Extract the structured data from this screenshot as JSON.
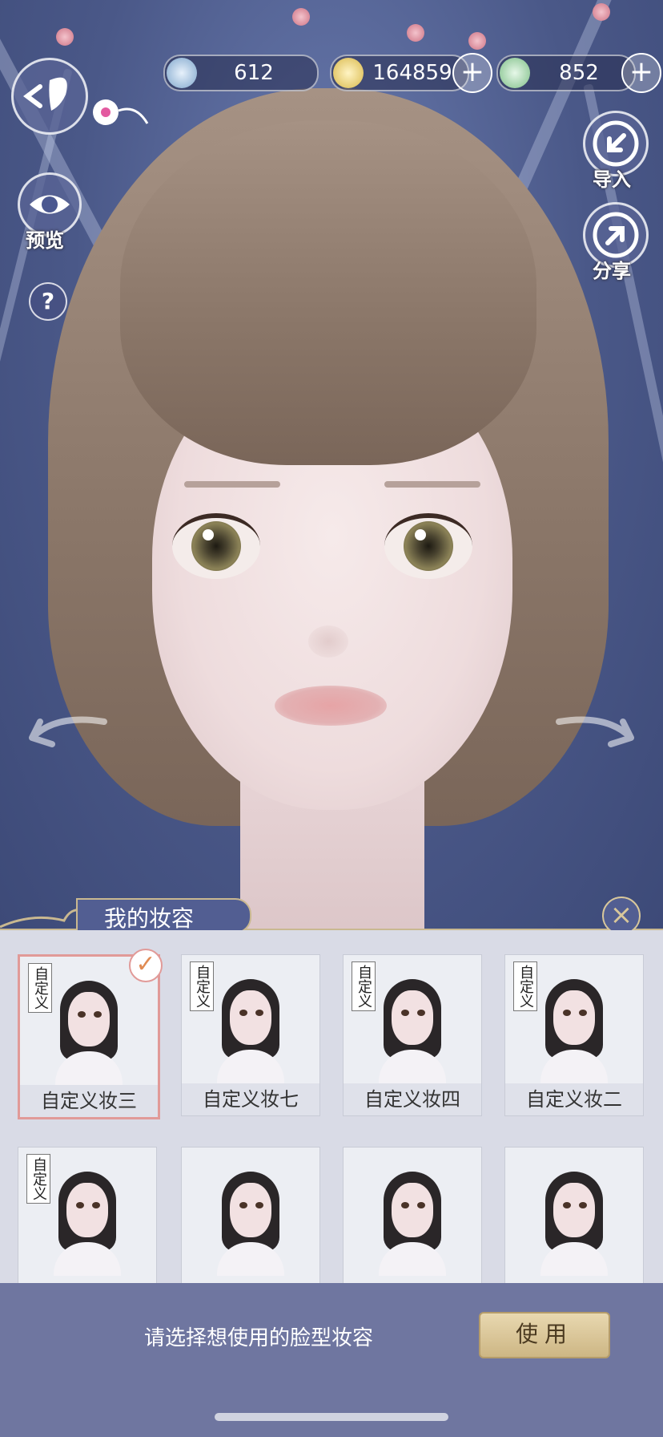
{
  "currencies": [
    {
      "name": "jade",
      "value": "612",
      "color": "#8fb6d8"
    },
    {
      "name": "copper-coin",
      "value": "164859",
      "color": "#e6cf7a"
    },
    {
      "name": "jade-token",
      "value": "852",
      "color": "#9fd6a4"
    }
  ],
  "left_controls": {
    "preview_label": "预览",
    "help_label": "?"
  },
  "right_controls": {
    "import_label": "导入",
    "share_label": "分享"
  },
  "panel": {
    "title": "我的妆容",
    "close_label": "×",
    "tag_text": "自定义",
    "checkmark": "✓",
    "cards": [
      {
        "caption": "自定义妆三",
        "selected": true,
        "custom": true
      },
      {
        "caption": "自定义妆七",
        "selected": false,
        "custom": true
      },
      {
        "caption": "自定义妆四",
        "selected": false,
        "custom": true
      },
      {
        "caption": "自定义妆二",
        "selected": false,
        "custom": true
      },
      {
        "caption": "",
        "selected": false,
        "custom": true
      },
      {
        "caption": "",
        "selected": false,
        "custom": false
      },
      {
        "caption": "",
        "selected": false,
        "custom": false
      },
      {
        "caption": "",
        "selected": false,
        "custom": false
      }
    ]
  },
  "footer": {
    "hint": "请选择想使用的脸型妆容",
    "use_label": "使用"
  },
  "colors": {
    "accent_gold": "#c9b890",
    "panel_bg": "#d9dbe6",
    "selected_border": "#e19a98"
  }
}
